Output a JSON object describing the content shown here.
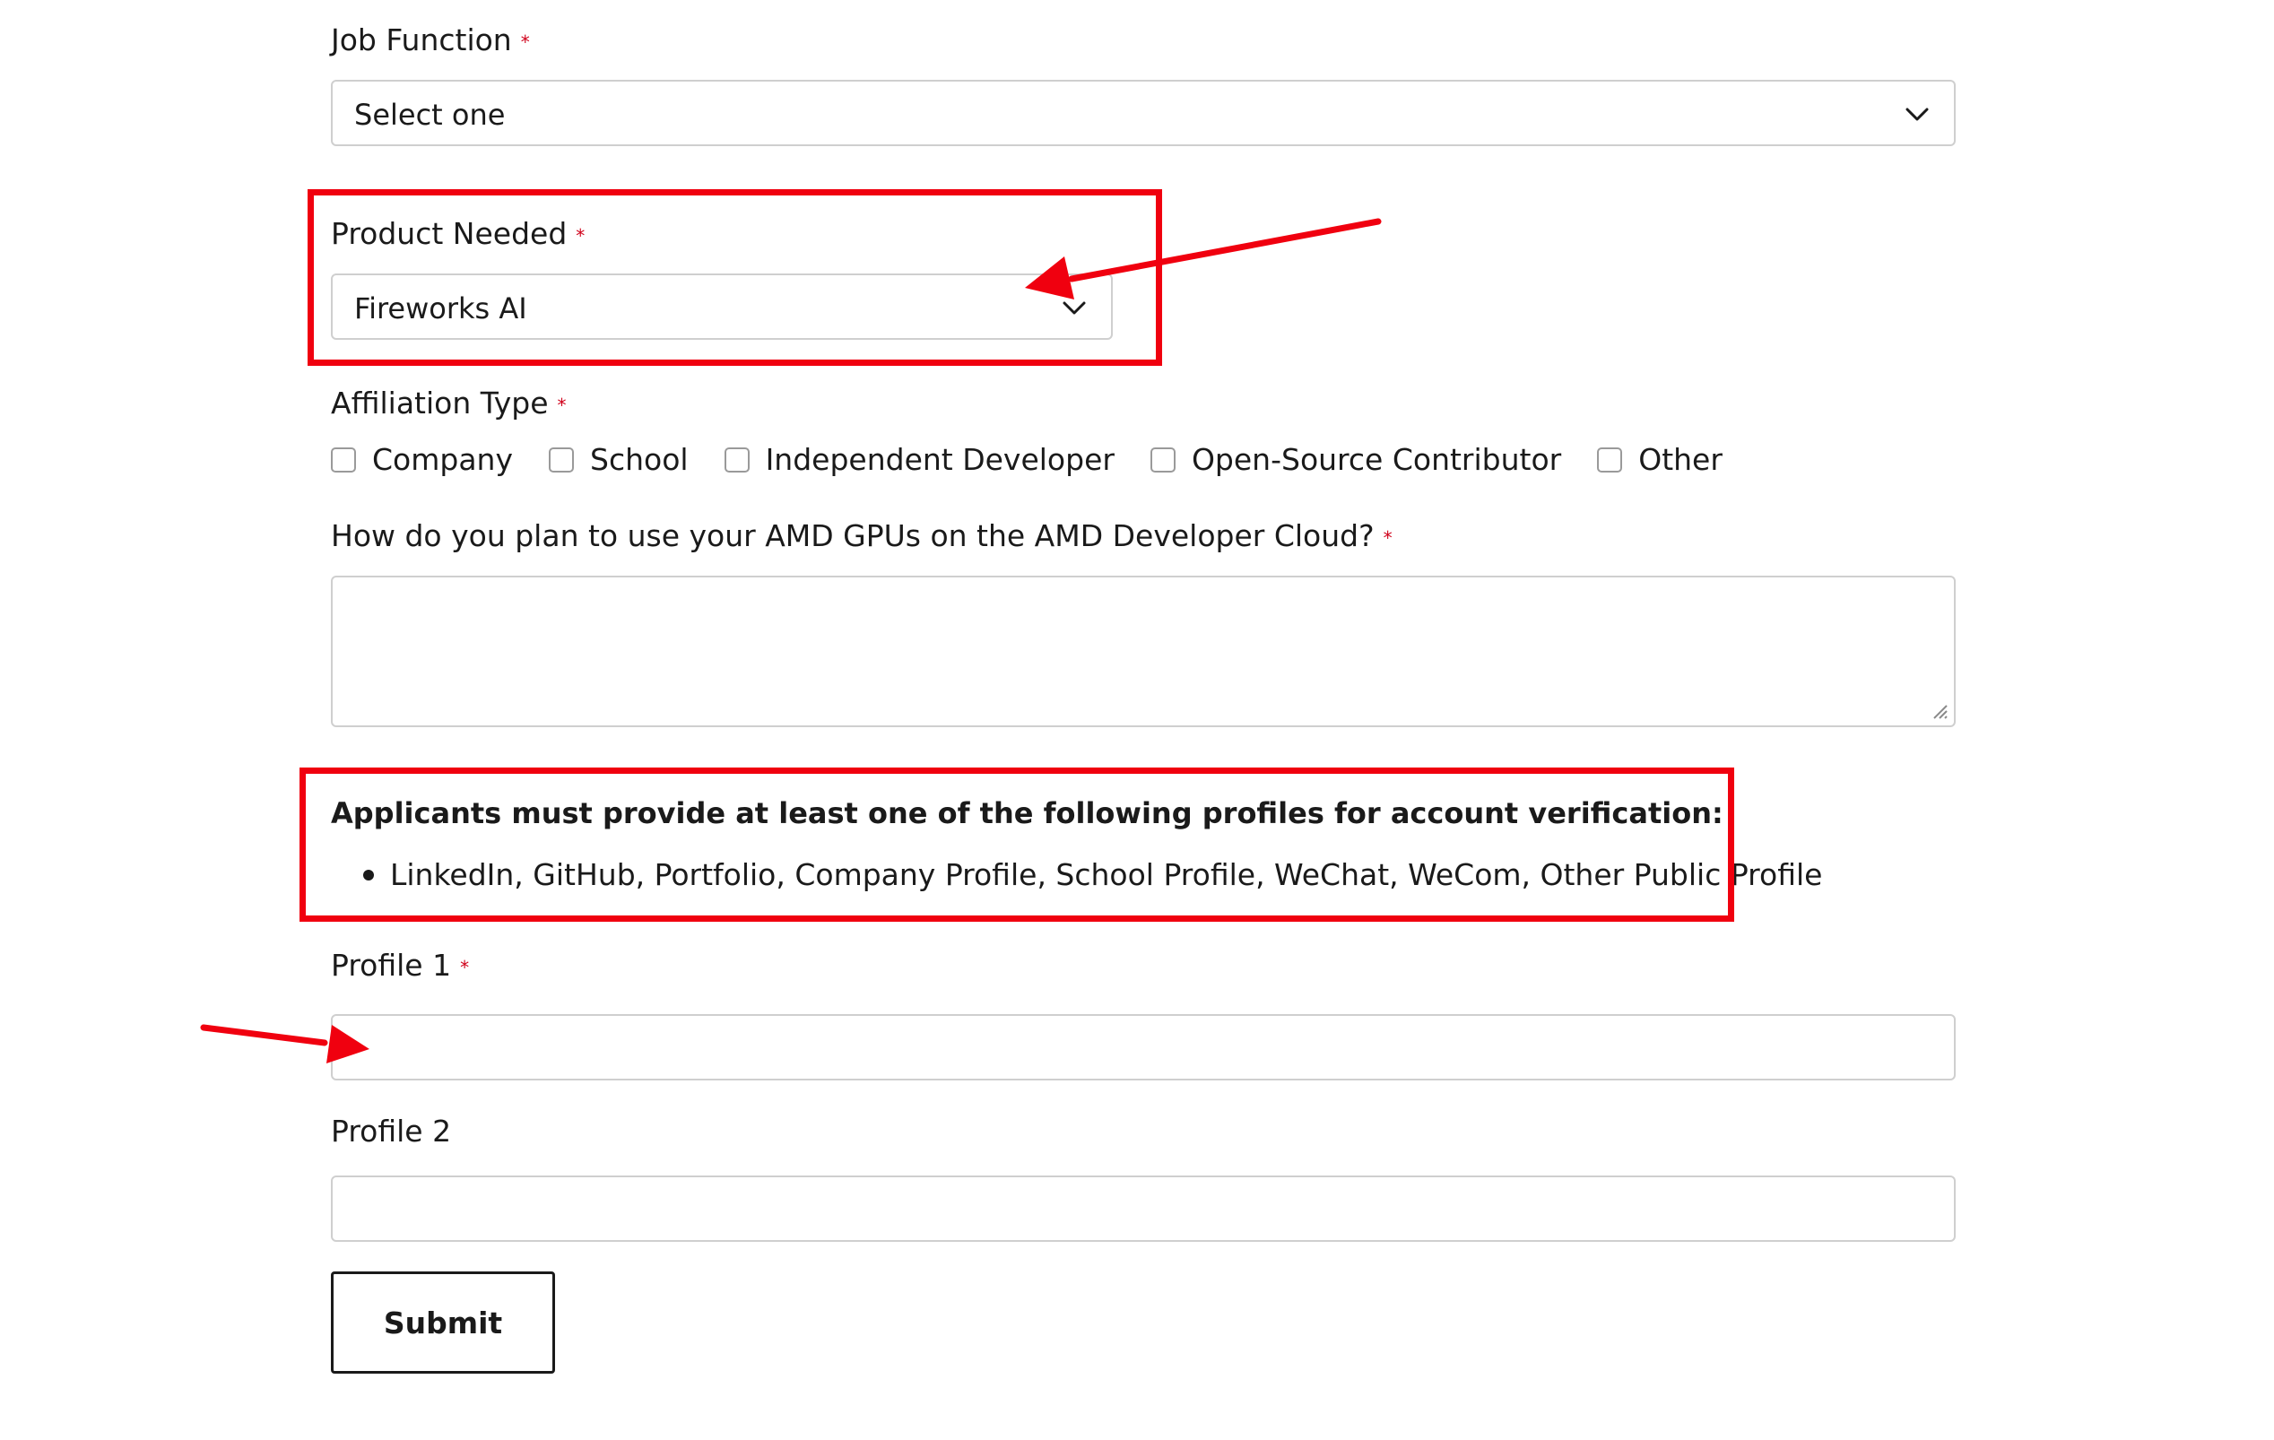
{
  "form": {
    "job_function": {
      "label": "Job Function",
      "required_mark": "*",
      "selected": "Select one",
      "icon": "chevron-down-icon"
    },
    "product_needed": {
      "label": "Product Needed",
      "required_mark": "*",
      "selected": "Fireworks AI",
      "icon": "chevron-down-icon"
    },
    "affiliation_type": {
      "label": "Affiliation Type",
      "required_mark": "*",
      "options": [
        {
          "label": "Company",
          "checked": false
        },
        {
          "label": "School",
          "checked": false
        },
        {
          "label": "Independent Developer",
          "checked": false
        },
        {
          "label": "Open-Source Contributor",
          "checked": false
        },
        {
          "label": "Other",
          "checked": false
        }
      ]
    },
    "plan_usage": {
      "label": "How do you plan to use your AMD GPUs on the AMD Developer Cloud?",
      "required_mark": "*",
      "value": ""
    },
    "notice": {
      "title": "Applicants must provide at least one of the following profiles for account verification:",
      "items": [
        "LinkedIn, GitHub, Portfolio, Company Profile, School Profile, WeChat, WeCom, Other Public Profile"
      ]
    },
    "profile_1": {
      "label": "Profile 1",
      "required_mark": "*",
      "value": ""
    },
    "profile_2": {
      "label": "Profile 2",
      "value": ""
    },
    "submit_label": "Submit"
  },
  "colors": {
    "annotation_red": "#f0000f",
    "required_red": "#d0021b",
    "border_gray": "#cfcfcf"
  }
}
